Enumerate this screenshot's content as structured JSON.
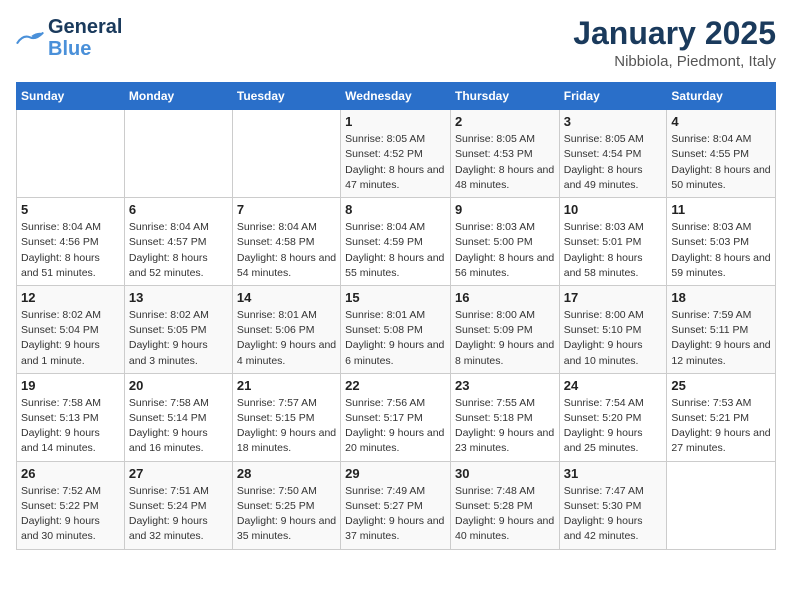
{
  "header": {
    "logo_general": "General",
    "logo_blue": "Blue",
    "title": "January 2025",
    "subtitle": "Nibbiola, Piedmont, Italy"
  },
  "days_of_week": [
    "Sunday",
    "Monday",
    "Tuesday",
    "Wednesday",
    "Thursday",
    "Friday",
    "Saturday"
  ],
  "weeks": [
    [
      {
        "day": "",
        "info": ""
      },
      {
        "day": "",
        "info": ""
      },
      {
        "day": "",
        "info": ""
      },
      {
        "day": "1",
        "info": "Sunrise: 8:05 AM\nSunset: 4:52 PM\nDaylight: 8 hours and 47 minutes."
      },
      {
        "day": "2",
        "info": "Sunrise: 8:05 AM\nSunset: 4:53 PM\nDaylight: 8 hours and 48 minutes."
      },
      {
        "day": "3",
        "info": "Sunrise: 8:05 AM\nSunset: 4:54 PM\nDaylight: 8 hours and 49 minutes."
      },
      {
        "day": "4",
        "info": "Sunrise: 8:04 AM\nSunset: 4:55 PM\nDaylight: 8 hours and 50 minutes."
      }
    ],
    [
      {
        "day": "5",
        "info": "Sunrise: 8:04 AM\nSunset: 4:56 PM\nDaylight: 8 hours and 51 minutes."
      },
      {
        "day": "6",
        "info": "Sunrise: 8:04 AM\nSunset: 4:57 PM\nDaylight: 8 hours and 52 minutes."
      },
      {
        "day": "7",
        "info": "Sunrise: 8:04 AM\nSunset: 4:58 PM\nDaylight: 8 hours and 54 minutes."
      },
      {
        "day": "8",
        "info": "Sunrise: 8:04 AM\nSunset: 4:59 PM\nDaylight: 8 hours and 55 minutes."
      },
      {
        "day": "9",
        "info": "Sunrise: 8:03 AM\nSunset: 5:00 PM\nDaylight: 8 hours and 56 minutes."
      },
      {
        "day": "10",
        "info": "Sunrise: 8:03 AM\nSunset: 5:01 PM\nDaylight: 8 hours and 58 minutes."
      },
      {
        "day": "11",
        "info": "Sunrise: 8:03 AM\nSunset: 5:03 PM\nDaylight: 8 hours and 59 minutes."
      }
    ],
    [
      {
        "day": "12",
        "info": "Sunrise: 8:02 AM\nSunset: 5:04 PM\nDaylight: 9 hours and 1 minute."
      },
      {
        "day": "13",
        "info": "Sunrise: 8:02 AM\nSunset: 5:05 PM\nDaylight: 9 hours and 3 minutes."
      },
      {
        "day": "14",
        "info": "Sunrise: 8:01 AM\nSunset: 5:06 PM\nDaylight: 9 hours and 4 minutes."
      },
      {
        "day": "15",
        "info": "Sunrise: 8:01 AM\nSunset: 5:08 PM\nDaylight: 9 hours and 6 minutes."
      },
      {
        "day": "16",
        "info": "Sunrise: 8:00 AM\nSunset: 5:09 PM\nDaylight: 9 hours and 8 minutes."
      },
      {
        "day": "17",
        "info": "Sunrise: 8:00 AM\nSunset: 5:10 PM\nDaylight: 9 hours and 10 minutes."
      },
      {
        "day": "18",
        "info": "Sunrise: 7:59 AM\nSunset: 5:11 PM\nDaylight: 9 hours and 12 minutes."
      }
    ],
    [
      {
        "day": "19",
        "info": "Sunrise: 7:58 AM\nSunset: 5:13 PM\nDaylight: 9 hours and 14 minutes."
      },
      {
        "day": "20",
        "info": "Sunrise: 7:58 AM\nSunset: 5:14 PM\nDaylight: 9 hours and 16 minutes."
      },
      {
        "day": "21",
        "info": "Sunrise: 7:57 AM\nSunset: 5:15 PM\nDaylight: 9 hours and 18 minutes."
      },
      {
        "day": "22",
        "info": "Sunrise: 7:56 AM\nSunset: 5:17 PM\nDaylight: 9 hours and 20 minutes."
      },
      {
        "day": "23",
        "info": "Sunrise: 7:55 AM\nSunset: 5:18 PM\nDaylight: 9 hours and 23 minutes."
      },
      {
        "day": "24",
        "info": "Sunrise: 7:54 AM\nSunset: 5:20 PM\nDaylight: 9 hours and 25 minutes."
      },
      {
        "day": "25",
        "info": "Sunrise: 7:53 AM\nSunset: 5:21 PM\nDaylight: 9 hours and 27 minutes."
      }
    ],
    [
      {
        "day": "26",
        "info": "Sunrise: 7:52 AM\nSunset: 5:22 PM\nDaylight: 9 hours and 30 minutes."
      },
      {
        "day": "27",
        "info": "Sunrise: 7:51 AM\nSunset: 5:24 PM\nDaylight: 9 hours and 32 minutes."
      },
      {
        "day": "28",
        "info": "Sunrise: 7:50 AM\nSunset: 5:25 PM\nDaylight: 9 hours and 35 minutes."
      },
      {
        "day": "29",
        "info": "Sunrise: 7:49 AM\nSunset: 5:27 PM\nDaylight: 9 hours and 37 minutes."
      },
      {
        "day": "30",
        "info": "Sunrise: 7:48 AM\nSunset: 5:28 PM\nDaylight: 9 hours and 40 minutes."
      },
      {
        "day": "31",
        "info": "Sunrise: 7:47 AM\nSunset: 5:30 PM\nDaylight: 9 hours and 42 minutes."
      },
      {
        "day": "",
        "info": ""
      }
    ]
  ]
}
